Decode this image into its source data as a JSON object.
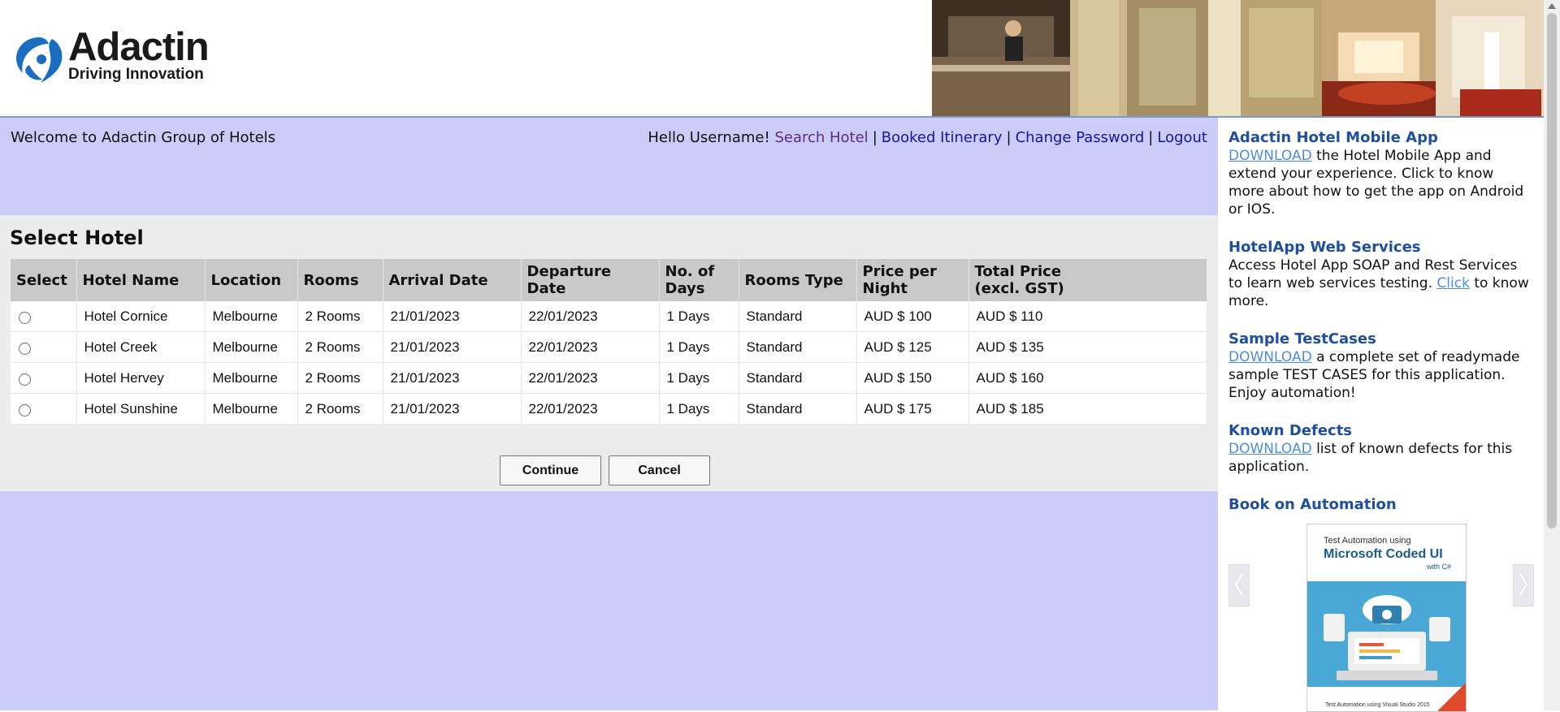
{
  "brand": {
    "name": "Adactin",
    "tagline": "Driving Innovation"
  },
  "header": {
    "welcome": "Welcome to Adactin Group of Hotels",
    "greeting": "Hello Username!",
    "nav": {
      "search_hotel": "Search Hotel",
      "booked_itinerary": "Booked Itinerary",
      "change_password": "Change Password",
      "logout": "Logout",
      "separator": "|"
    }
  },
  "select_hotel": {
    "title": "Select Hotel",
    "columns": {
      "select": "Select",
      "hotel_name": "Hotel Name",
      "location": "Location",
      "rooms": "Rooms",
      "arrival_date": "Arrival Date",
      "departure_date": "Departure Date",
      "no_of_days_1": "No. of",
      "no_of_days_2": "Days",
      "rooms_type": "Rooms Type",
      "price_per_night_1": "Price per",
      "price_per_night_2": "Night",
      "total_price_1": "Total Price",
      "total_price_2": "(excl. GST)"
    },
    "rows": [
      {
        "hotel_name": "Hotel Cornice",
        "location": "Melbourne",
        "rooms": "2 Rooms",
        "arrival": "21/01/2023",
        "departure": "22/01/2023",
        "days": "1 Days",
        "type": "Standard",
        "price": "AUD $ 100",
        "total": "AUD $ 110"
      },
      {
        "hotel_name": "Hotel Creek",
        "location": "Melbourne",
        "rooms": "2 Rooms",
        "arrival": "21/01/2023",
        "departure": "22/01/2023",
        "days": "1 Days",
        "type": "Standard",
        "price": "AUD $ 125",
        "total": "AUD $ 135"
      },
      {
        "hotel_name": "Hotel Hervey",
        "location": "Melbourne",
        "rooms": "2 Rooms",
        "arrival": "21/01/2023",
        "departure": "22/01/2023",
        "days": "1 Days",
        "type": "Standard",
        "price": "AUD $ 150",
        "total": "AUD $ 160"
      },
      {
        "hotel_name": "Hotel Sunshine",
        "location": "Melbourne",
        "rooms": "2 Rooms",
        "arrival": "21/01/2023",
        "departure": "22/01/2023",
        "days": "1 Days",
        "type": "Standard",
        "price": "AUD $ 175",
        "total": "AUD $ 185"
      }
    ],
    "continue_label": "Continue",
    "cancel_label": "Cancel"
  },
  "sidebar": {
    "mobile_app": {
      "title": "Adactin Hotel Mobile App",
      "link": "DOWNLOAD",
      "text": " the Hotel Mobile App and extend your experience. Click to know more about how to get the app on Android or IOS."
    },
    "web_services": {
      "title": "HotelApp Web Services",
      "text_before": "Access Hotel App SOAP and Rest Services to learn web services testing. ",
      "link": "Click",
      "text_after": " to know more."
    },
    "test_cases": {
      "title": "Sample TestCases",
      "link": "DOWNLOAD",
      "text": " a complete set of readymade sample TEST CASES for this application. Enjoy automation!"
    },
    "known_defects": {
      "title": "Known Defects",
      "link": "DOWNLOAD",
      "text": " list of known defects for this application."
    },
    "book": {
      "title": "Book on Automation",
      "cover_line1": "Test Automation using",
      "cover_line2": "Microsoft Coded UI",
      "cover_line3": "with C#",
      "cover_caption": "Test Automation using Visual Studio 2015"
    }
  },
  "colors": {
    "main_bg": "#ccccf8",
    "panel_bg": "#ececec",
    "table_header_bg": "#c9c9c9",
    "nav_link": "#1414a8",
    "sidebar_title": "#1f4fa0",
    "sidebar_link": "#4c8de0"
  }
}
